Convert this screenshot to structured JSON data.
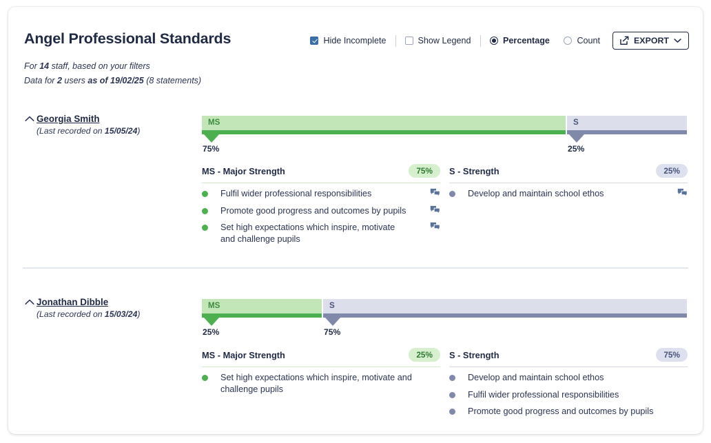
{
  "header": {
    "title": "Angel Professional Standards",
    "subtitle_1_pre": "For ",
    "subtitle_1_strong": "14",
    "subtitle_1_post": " staff, based on your filters",
    "subtitle_2_pre": "Data for ",
    "subtitle_2_strong_a": "2",
    "subtitle_2_mid": " users ",
    "subtitle_2_strong_b": "as of 19/02/25",
    "subtitle_2_post": " (8 statements)"
  },
  "controls": {
    "hide_incomplete_label": "Hide Incomplete",
    "hide_incomplete_checked": true,
    "show_legend_label": "Show Legend",
    "show_legend_checked": false,
    "percentage_label": "Percentage",
    "percentage_selected": true,
    "count_label": "Count",
    "count_selected": false,
    "export_label": "EXPORT"
  },
  "colors": {
    "ms_fill": "#c3e6b8",
    "ms_border": "#4caf50",
    "ms_text": "#3b8c3f",
    "s_fill": "#dcdfeb",
    "s_border": "#8189ab",
    "s_text": "#4a5478",
    "accent_blue": "#3a6ea5",
    "heading": "#1f2a44"
  },
  "chart_data": {
    "type": "bar",
    "title": "Angel Professional Standards",
    "orientation": "horizontal-stacked",
    "categories": [
      "Georgia Smith",
      "Jonathan Dibble"
    ],
    "series": [
      {
        "name": "MS - Major Strength",
        "code": "MS",
        "values": [
          75,
          25
        ],
        "color": "#4caf50"
      },
      {
        "name": "S - Strength",
        "code": "S",
        "values": [
          25,
          75
        ],
        "color": "#8189ab"
      }
    ],
    "value_unit": "%",
    "ylim": [
      0,
      100
    ],
    "grid": false,
    "legend": false
  },
  "people": [
    {
      "name": "Georgia Smith",
      "last_recorded_prefix": "(Last recorded on ",
      "last_recorded_date": "15/05/24",
      "last_recorded_suffix": ")",
      "segments": [
        {
          "code": "MS",
          "percent_label": "75%",
          "percent": 75
        },
        {
          "code": "S",
          "percent_label": "25%",
          "percent": 25
        }
      ],
      "columns": [
        {
          "title": "MS - Major Strength",
          "pill": "75%",
          "statements": [
            {
              "text": "Fulfil wider professional responsibilities",
              "has_comment": true
            },
            {
              "text": "Promote good progress and outcomes by pupils",
              "has_comment": true
            },
            {
              "text": "Set high expectations which inspire, motivate and challenge pupils",
              "has_comment": true
            }
          ]
        },
        {
          "title": "S - Strength",
          "pill": "25%",
          "statements": [
            {
              "text": "Develop and maintain school ethos",
              "has_comment": true
            }
          ]
        }
      ]
    },
    {
      "name": "Jonathan Dibble",
      "last_recorded_prefix": "(Last recorded on ",
      "last_recorded_date": "15/03/24",
      "last_recorded_suffix": ")",
      "segments": [
        {
          "code": "MS",
          "percent_label": "25%",
          "percent": 25
        },
        {
          "code": "S",
          "percent_label": "75%",
          "percent": 75
        }
      ],
      "columns": [
        {
          "title": "MS - Major Strength",
          "pill": "25%",
          "statements": [
            {
              "text": "Set high expectations which inspire, motivate and challenge pupils",
              "has_comment": false
            }
          ]
        },
        {
          "title": "S - Strength",
          "pill": "75%",
          "statements": [
            {
              "text": "Develop and maintain school ethos",
              "has_comment": false
            },
            {
              "text": "Fulfil wider professional responsibilities",
              "has_comment": false
            },
            {
              "text": "Promote good progress and outcomes by pupils",
              "has_comment": false
            }
          ]
        }
      ]
    }
  ]
}
